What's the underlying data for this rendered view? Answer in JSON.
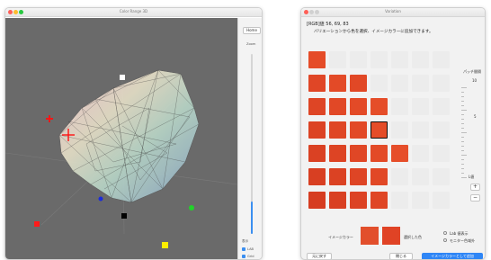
{
  "left_window": {
    "title": "Color Range 3D",
    "side": {
      "top_button": "Home",
      "zoom_label": "Zoom",
      "zoom_level": 0.18,
      "checkbox_heading": "表示",
      "checkbox_1": "LAB",
      "checkbox_2": "Grid"
    }
  },
  "right_window": {
    "title": "Variation",
    "rgb_label": "[RGB]値  56, 69, 83",
    "instruction": "バリエーションから色を選択、イメージカラーに追加できます。",
    "patch_label": "パッチ間隔",
    "scale_top": "10",
    "scale_mid": "5",
    "scale_bottom": "1",
    "step_label": "L値",
    "plus_label": "+",
    "minus_label": "−",
    "image_color_label": "イメージカラー",
    "selected_label": "選択した色",
    "radio_1": "Lab 値表示",
    "radio_2": "モニター色域外",
    "buttons": {
      "back": "元に戻す",
      "close": "閉じる",
      "add": "イメージカラーとして追加"
    },
    "colors": {
      "accent": "#2f86f6",
      "swatch_selected": "#e24f2c",
      "swatch_image": "#e04325"
    }
  }
}
